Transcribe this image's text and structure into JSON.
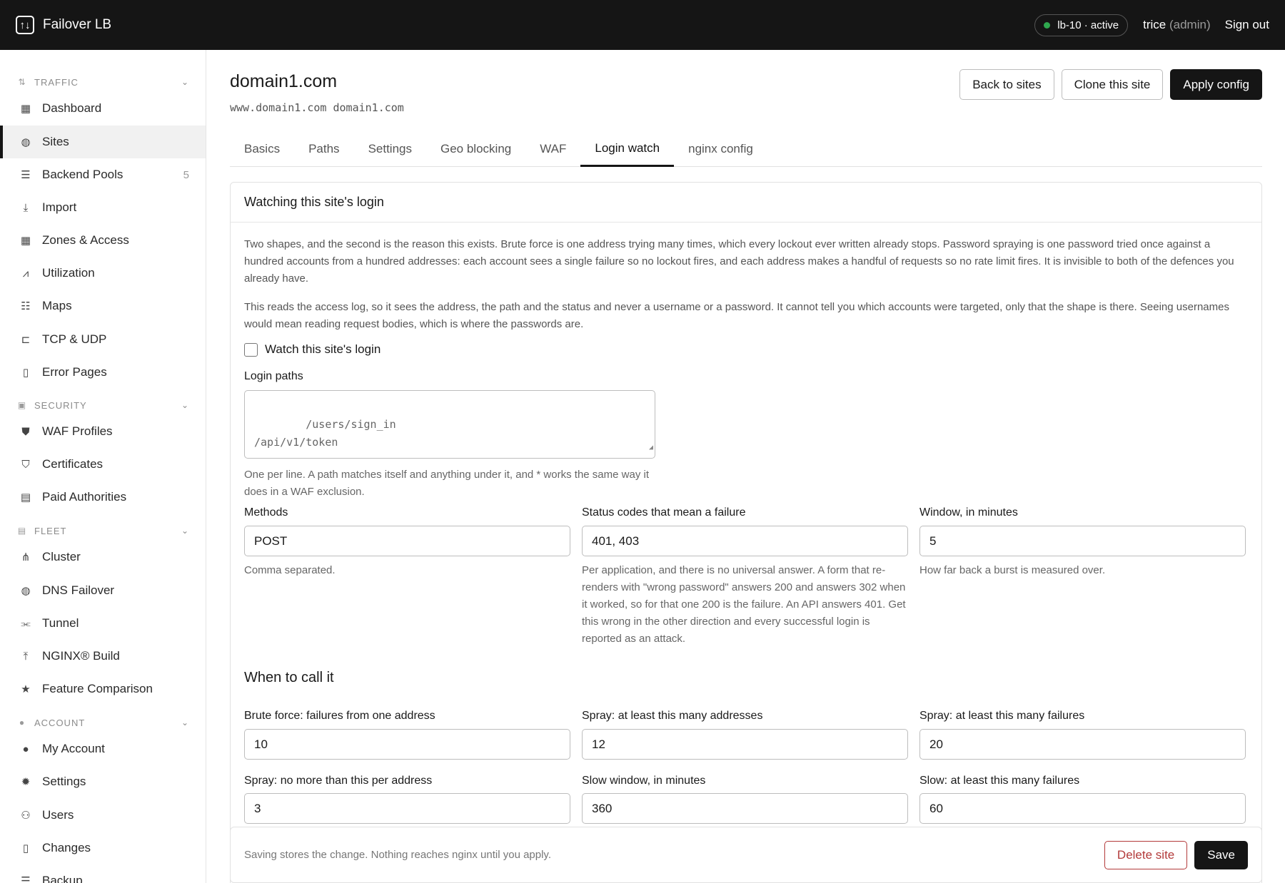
{
  "topbar": {
    "brand_glyph": "↑↓",
    "brand_name": "Failover LB",
    "node_status": "lb-10 · active",
    "user_name": "trice",
    "user_role": "(admin)",
    "signout": "Sign out"
  },
  "sidebar": {
    "traffic_label": "TRAFFIC",
    "security_label": "SECURITY",
    "fleet_label": "FLEET",
    "account_label": "ACCOUNT",
    "items": {
      "dashboard": "Dashboard",
      "sites": "Sites",
      "backend_pools": "Backend Pools",
      "backend_pools_count": "5",
      "import": "Import",
      "zones": "Zones & Access",
      "utilization": "Utilization",
      "maps": "Maps",
      "tcp_udp": "TCP & UDP",
      "error_pages": "Error Pages",
      "waf_profiles": "WAF Profiles",
      "certificates": "Certificates",
      "paid_authorities": "Paid Authorities",
      "cluster": "Cluster",
      "dns_failover": "DNS Failover",
      "tunnel": "Tunnel",
      "nginx_build": "NGINX® Build",
      "feature_comparison": "Feature Comparison",
      "my_account": "My Account",
      "settings": "Settings",
      "users": "Users",
      "changes": "Changes",
      "backup": "Backup"
    }
  },
  "page": {
    "title": "domain1.com",
    "aliases": "www.domain1.com domain1.com",
    "back_button": "Back to sites",
    "clone_button": "Clone this site",
    "apply_button": "Apply config"
  },
  "tabs": {
    "basics": "Basics",
    "paths": "Paths",
    "settings": "Settings",
    "geo": "Geo blocking",
    "waf": "WAF",
    "login_watch": "Login watch",
    "nginx": "nginx config"
  },
  "card": {
    "title": "Watching this site's login",
    "para1": "Two shapes, and the second is the reason this exists. Brute force is one address trying many times, which every lockout ever written already stops. Password spraying is one password tried once against a hundred accounts from a hundred addresses: each account sees a single failure so no lockout fires, and each address makes a handful of requests so no rate limit fires. It is invisible to both of the defences you already have.",
    "para2": "This reads the access log, so it sees the address, the path and the status and never a username or a password. It cannot tell you which accounts were targeted, only that the shape is there. Seeing usernames would mean reading request bodies, which is where the passwords are.",
    "watch_label": "Watch this site's login",
    "login_paths_label": "Login paths",
    "login_paths_placeholder": "/users/sign_in\n/api/v1/token",
    "login_paths_help": "One per line. A path matches itself and anything under it, and * works the same way it does in a WAF exclusion.",
    "methods_label": "Methods",
    "methods_value": "POST",
    "methods_help": "Comma separated.",
    "status_label": "Status codes that mean a failure",
    "status_value": "401, 403",
    "status_help": "Per application, and there is no universal answer. A form that re-renders with \"wrong password\" answers 200 and answers 302 when it worked, so for that one 200 is the failure. An API answers 401. Get this wrong in the other direction and every successful login is reported as an attack.",
    "window_label": "Window, in minutes",
    "window_value": "5",
    "window_help": "How far back a burst is measured over.",
    "when_heading": "When to call it",
    "brute_label": "Brute force: failures from one address",
    "brute_value": "10",
    "spray_addr_label": "Spray: at least this many addresses",
    "spray_addr_value": "12",
    "spray_fail_label": "Spray: at least this many failures",
    "spray_fail_value": "20",
    "spray_per_label": "Spray: no more than this per address",
    "spray_per_value": "3",
    "slow_window_label": "Slow window, in minutes",
    "slow_window_value": "360",
    "slow_fail_label": "Slow: at least this many failures",
    "slow_fail_value": "60"
  },
  "footer": {
    "note": "Saving stores the change. Nothing reaches nginx until you apply.",
    "delete_button": "Delete site",
    "save_button": "Save"
  }
}
